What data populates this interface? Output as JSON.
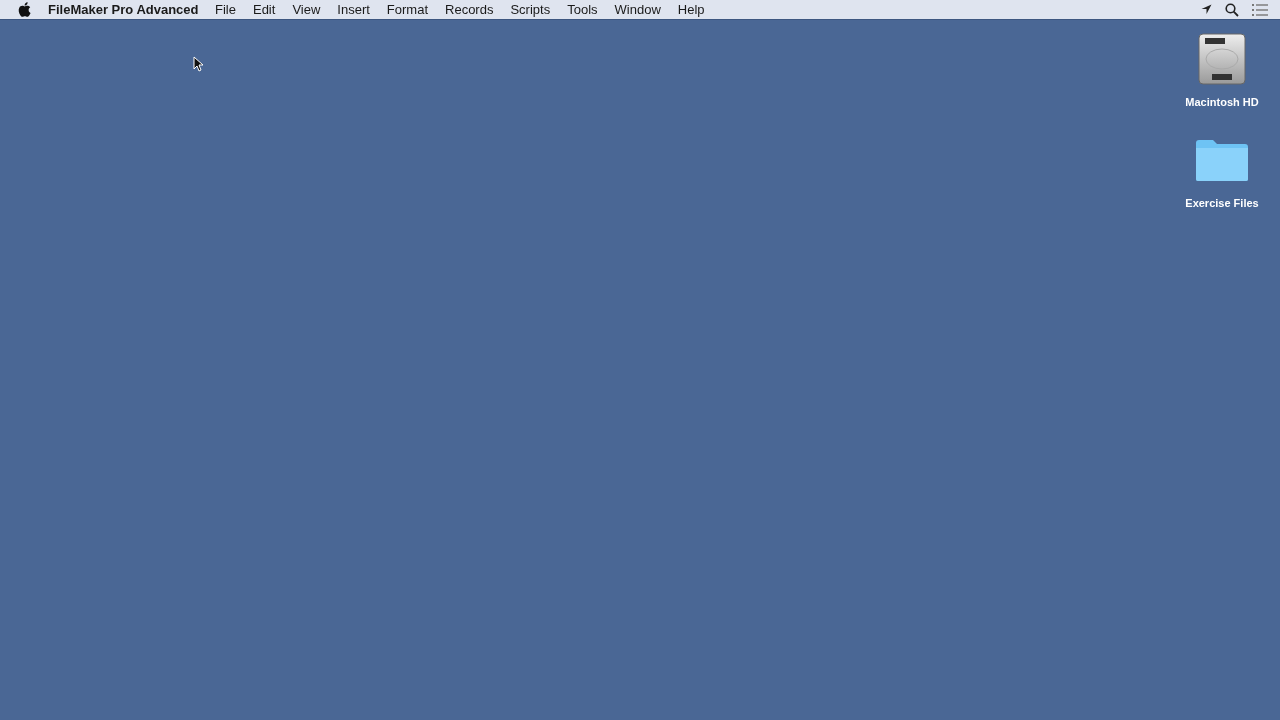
{
  "menu_bar": {
    "app_name": "FileMaker Pro Advanced",
    "menus": [
      "File",
      "Edit",
      "View",
      "Insert",
      "Format",
      "Records",
      "Scripts",
      "Tools",
      "Window",
      "Help"
    ]
  },
  "desktop_icons": [
    {
      "kind": "drive",
      "label": "Macintosh HD"
    },
    {
      "kind": "folder",
      "label": "Exercise Files"
    }
  ]
}
